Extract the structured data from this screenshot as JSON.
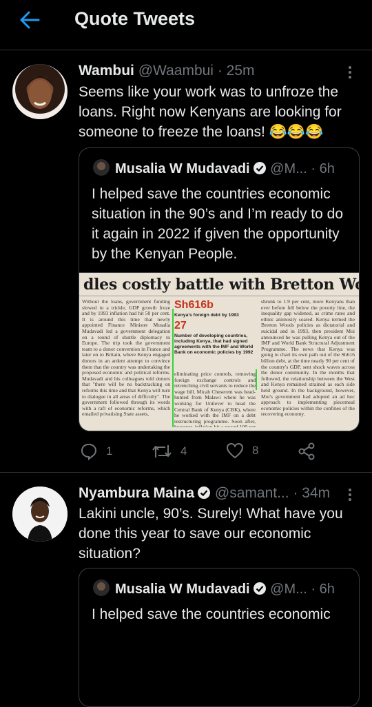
{
  "header": {
    "title": "Quote Tweets",
    "back_icon": "arrow-left-icon",
    "accent": "#1d9bf0"
  },
  "tweets": [
    {
      "name": "Wambui",
      "handle": "@Waambui",
      "time": "· 25m",
      "text": "Seems like your work was to unfroze the loans. Right now Kenyans are looking for someone to freeze the loans! 😂😂😂",
      "quote": {
        "name": "Musalia W Mudavadi",
        "handle": "@M...",
        "time": "· 6h",
        "text": "I helped save the countries economic situation in the 90’s and I’m ready to do it again in 2022 if given the opportunity by the Kenyan People.",
        "image": {
          "headline": "dles costly battle with Bretton Woods ins",
          "stat1": "Sh616b",
          "stat1_label": "Kenya's foreign debt by 1993",
          "stat2": "27",
          "stat2_label": "Number of developing countries, including Kenya, that had signed agreements with the IMF and World Bank on economic policies by 1992",
          "col1": "Without the loans, government funding slowed to a trickle, GDP growth froze and by 1993 inflation had hit 50 per cent. It is around this time that newly appointed Finance Minister Musalia Mudavadi led a government delegation on a round of shuttle diplomacy to Europe. The trip took the government team to a donor convention in France and later on to Britain, where Kenya engaged donors in an ardent attempt to convince them that the country was undertaking the proposed economic and political reforms. Mudavadi and his colleagues told donors that \"there will be no backtracking on reforms this time and that Kenya will turn to dialogue in all areas of difficulty\". The government followed through its words with a raft of economic reforms, which entailed privatising State assets,",
          "col2": "eliminating price controls, removing foreign exchange controls and retrenching civil servants to reduce the wage bill. Micah Cheserem was head-hunted from Malawi where he was working for Unilever to head the Central Bank of Kenya (CBK), where he worked with the IMF on a debt restructuring programme. Soon after, however, inflation hit a record 100 per cent and job creation",
          "col3": "shrunk to 1.9 per cent, more Kenyans than ever before fell below the poverty line, the inequality gap widened, as crime rates and ethnic animosity soared. Kenya termed the Bretton Woods policies as dictatorial and suicidal and in 1993, then president Moi announced he was pulling Kenya out of the IMF and World Bank Structural Adjustment Programme. The news that Kenya was going to chart its own path out of the Sh616 billion debt, at the time nearly 90 per cent of the country's GDP, sent shock waves across the donor community. In the months that followed, the relationship between the West and Kenya remained strained as each side held ground. In the background, however, Moi's government had adopted an ad hoc approach to implementing piecemeal economic policies within the confines of the recovering economy."
        }
      },
      "actions": {
        "reply": "1",
        "retweet": "4",
        "like": "8"
      }
    },
    {
      "name": "Nyambura Maina",
      "handle": "@samant...",
      "time": "· 34m",
      "text": "Lakini uncle, 90’s. Surely!  What have you done this year to save our economic situation?",
      "quote": {
        "name": "Musalia W Mudavadi",
        "handle": "@M...",
        "time": "· 6h",
        "text": "I helped save the countries economic"
      }
    }
  ]
}
